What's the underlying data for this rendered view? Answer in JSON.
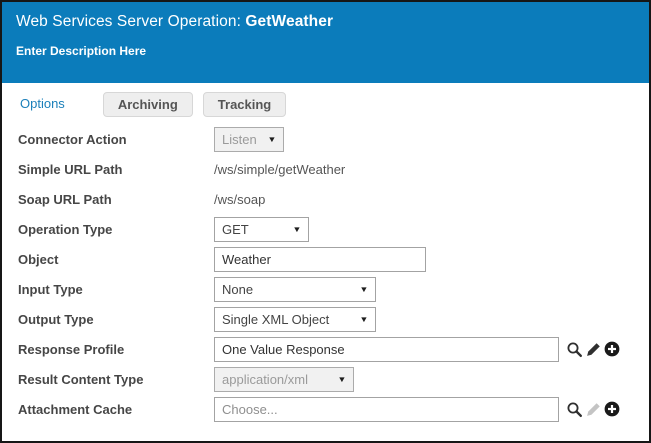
{
  "header": {
    "title_prefix": "Web Services Server Operation: ",
    "title_name": "GetWeather",
    "description": "Enter Description Here"
  },
  "tabs": [
    {
      "label": "Options",
      "active": true
    },
    {
      "label": "Archiving",
      "active": false
    },
    {
      "label": "Tracking",
      "active": false
    }
  ],
  "form": {
    "connector_action": {
      "label": "Connector Action",
      "value": "Listen",
      "disabled": true
    },
    "simple_url_path": {
      "label": "Simple URL Path",
      "value": "/ws/simple/getWeather"
    },
    "soap_url_path": {
      "label": "Soap URL Path",
      "value": "/ws/soap"
    },
    "operation_type": {
      "label": "Operation Type",
      "value": "GET"
    },
    "object": {
      "label": "Object",
      "value": "Weather"
    },
    "input_type": {
      "label": "Input Type",
      "value": "None"
    },
    "output_type": {
      "label": "Output Type",
      "value": "Single XML Object"
    },
    "response_profile": {
      "label": "Response Profile",
      "value": "One Value Response"
    },
    "result_content_type": {
      "label": "Result Content Type",
      "value": "application/xml",
      "disabled": true
    },
    "attachment_cache": {
      "label": "Attachment Cache",
      "placeholder": "Choose..."
    }
  },
  "icons": {
    "search": "magnifier",
    "edit": "pencil",
    "add": "plus-in-black-circle",
    "dropdown": "caret-down"
  },
  "colors": {
    "header_bg": "#0b7cbb",
    "tab_active_text": "#1c80ba",
    "tab_inactive_bg": "#eeeeee",
    "label_text": "#464646",
    "icon_dark": "#2f2f2f",
    "icon_disabled": "#c4c4c4",
    "add_icon_bg": "#1a1a1a"
  }
}
